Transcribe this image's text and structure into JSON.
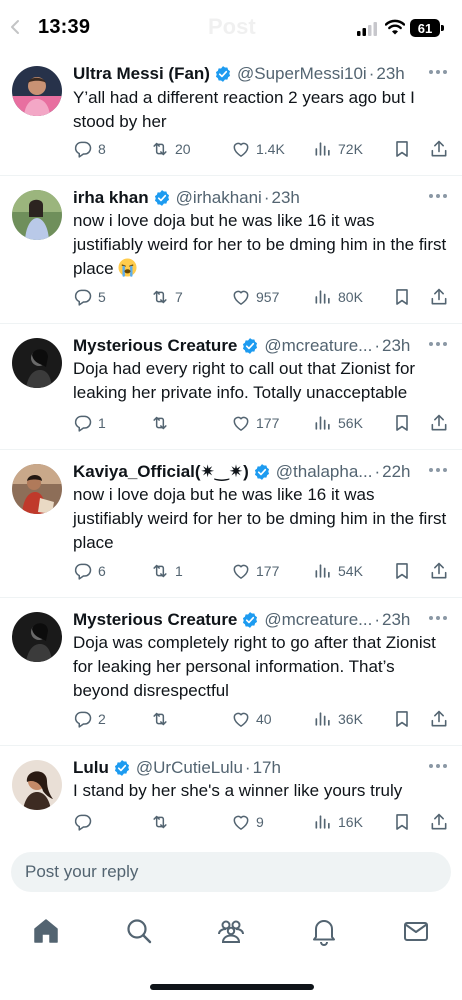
{
  "status_bar": {
    "time": "13:39",
    "battery": "61"
  },
  "header": {
    "title": "Post"
  },
  "replies": [
    {
      "name": "Ultra Messi (Fan)",
      "verified": true,
      "handle": "@SuperMessi10i",
      "time": "23h",
      "text": "Y’all had a different reaction 2 years ago but I stood by her",
      "counts": {
        "replies": "8",
        "reposts": "20",
        "likes": "1.4K",
        "views": "72K"
      }
    },
    {
      "name": "irha khan",
      "verified": true,
      "handle": "@irhakhani",
      "time": "23h",
      "text": "now i love doja but he was like 16 it was justifiably weird for her to be dming him in the first place",
      "counts": {
        "replies": "5",
        "reposts": "7",
        "likes": "957",
        "views": "80K"
      }
    },
    {
      "name": "Mysterious Creature",
      "verified": true,
      "handle": "@mcreature...",
      "time": "23h",
      "text": "Doja had every right to call out that Zionist for leaking her private info. Totally unacceptable",
      "counts": {
        "replies": "1",
        "reposts": "",
        "likes": "177",
        "views": "56K"
      }
    },
    {
      "name": "Kaviya_Official(✷‿✷)",
      "verified": true,
      "handle": "@thalapha...",
      "time": "22h",
      "text": "now i love doja but he was like 16 it was justifiably weird for her to be dming him in the first place",
      "counts": {
        "replies": "6",
        "reposts": "1",
        "likes": "177",
        "views": "54K"
      }
    },
    {
      "name": "Mysterious Creature",
      "verified": true,
      "handle": "@mcreature...",
      "time": "23h",
      "text": "Doja was completely right to go after that Zionist for leaking her personal information. That’s beyond disrespectful",
      "counts": {
        "replies": "2",
        "reposts": "",
        "likes": "40",
        "views": "36K"
      }
    },
    {
      "name": "Lulu",
      "verified": true,
      "handle": "@UrCutieLulu",
      "time": "17h",
      "text": "I stand by her she's a winner like yours truly",
      "counts": {
        "replies": "",
        "reposts": "",
        "likes": "9",
        "views": "16K"
      }
    }
  ],
  "reply_box": {
    "placeholder": "Post your reply"
  },
  "colors": {
    "verified": "#1d9bf0",
    "text": "#0f1419",
    "secondary": "#536471",
    "divider": "#eff3f4"
  },
  "icons": {
    "action_bar": [
      "reply-icon",
      "repost-icon",
      "like-icon",
      "views-icon",
      "bookmark-icon",
      "share-icon"
    ],
    "tab_bar": [
      "home-icon",
      "search-icon",
      "communities-icon",
      "notifications-icon",
      "messages-icon"
    ]
  }
}
